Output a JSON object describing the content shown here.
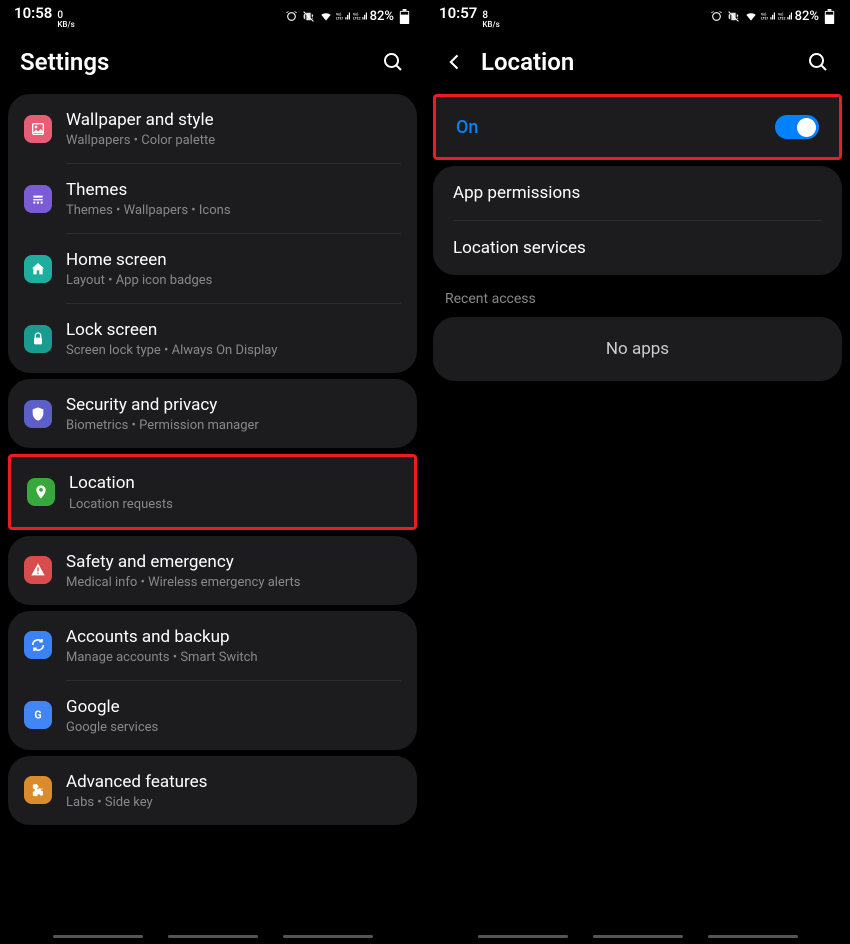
{
  "left": {
    "status": {
      "time": "10:58",
      "kbs_num": "0",
      "kbs_label": "KB/s",
      "battery": "82%"
    },
    "title": "Settings",
    "groups": [
      [
        {
          "icon": "wallpaper",
          "color": "bg-pink",
          "title": "Wallpaper and style",
          "sub": "Wallpapers • Color palette"
        },
        {
          "icon": "themes",
          "color": "bg-purple",
          "title": "Themes",
          "sub": "Themes • Wallpapers • Icons"
        },
        {
          "icon": "home",
          "color": "bg-teal",
          "title": "Home screen",
          "sub": "Layout • App icon badges"
        },
        {
          "icon": "lock",
          "color": "bg-teal2",
          "title": "Lock screen",
          "sub": "Screen lock type • Always On Display"
        }
      ],
      [
        {
          "icon": "shield",
          "color": "bg-indigo",
          "title": "Security and privacy",
          "sub": "Biometrics • Permission manager"
        },
        {
          "icon": "pin",
          "color": "bg-green",
          "title": "Location",
          "sub": "Location requests",
          "highlight": true
        },
        {
          "icon": "alert",
          "color": "bg-red",
          "title": "Safety and emergency",
          "sub": "Medical info • Wireless emergency alerts"
        }
      ],
      [
        {
          "icon": "sync",
          "color": "bg-blue",
          "title": "Accounts and backup",
          "sub": "Manage accounts • Smart Switch"
        },
        {
          "icon": "google",
          "color": "bg-gblue",
          "title": "Google",
          "sub": "Google services"
        }
      ],
      [
        {
          "icon": "puzzle",
          "color": "bg-orange",
          "title": "Advanced features",
          "sub": "Labs • Side key"
        }
      ]
    ]
  },
  "right": {
    "status": {
      "time": "10:57",
      "kbs_num": "8",
      "kbs_label": "KB/s",
      "battery": "82%"
    },
    "title": "Location",
    "on_label": "On",
    "items": [
      "App permissions",
      "Location services"
    ],
    "section_label": "Recent access",
    "no_apps": "No apps"
  }
}
